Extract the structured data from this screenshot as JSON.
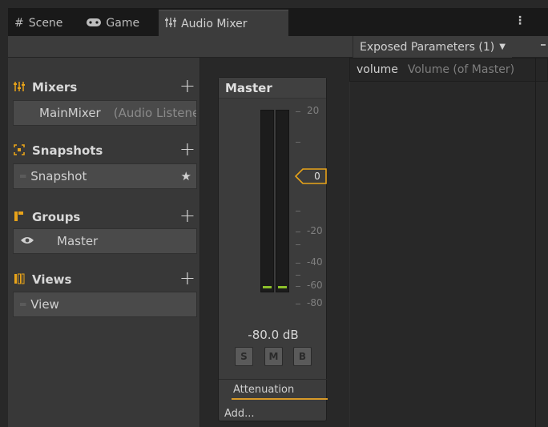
{
  "tabs": [
    {
      "label": "Scene",
      "icon": "grid-icon"
    },
    {
      "label": "Game",
      "icon": "gamepad-icon"
    },
    {
      "label": "Audio Mixer",
      "icon": "mixer-icon"
    }
  ],
  "toolbar": {
    "exposed_label": "Exposed Parameters (1)"
  },
  "exposed": {
    "name": "volume",
    "desc": "Volume (of Master)"
  },
  "sections": {
    "mixers": {
      "title": "Mixers",
      "item": "MainMixer",
      "item_sub": "(Audio Listener)"
    },
    "snapshots": {
      "title": "Snapshots",
      "item": "Snapshot"
    },
    "groups": {
      "title": "Groups",
      "item": "Master"
    },
    "views": {
      "title": "Views",
      "item": "View"
    }
  },
  "strip": {
    "title": "Master",
    "db_readout": "-80.0 dB",
    "fader_value": "0",
    "scale": [
      "20",
      "-20",
      "-40",
      "-60",
      "-80"
    ],
    "buttons": [
      "S",
      "M",
      "B"
    ],
    "effect": "Attenuation",
    "add_label": "Add..."
  },
  "colors": {
    "accent": "#e8a319",
    "meter_level": "#8cbf2a",
    "attenuation_underline": "#d89a28"
  }
}
